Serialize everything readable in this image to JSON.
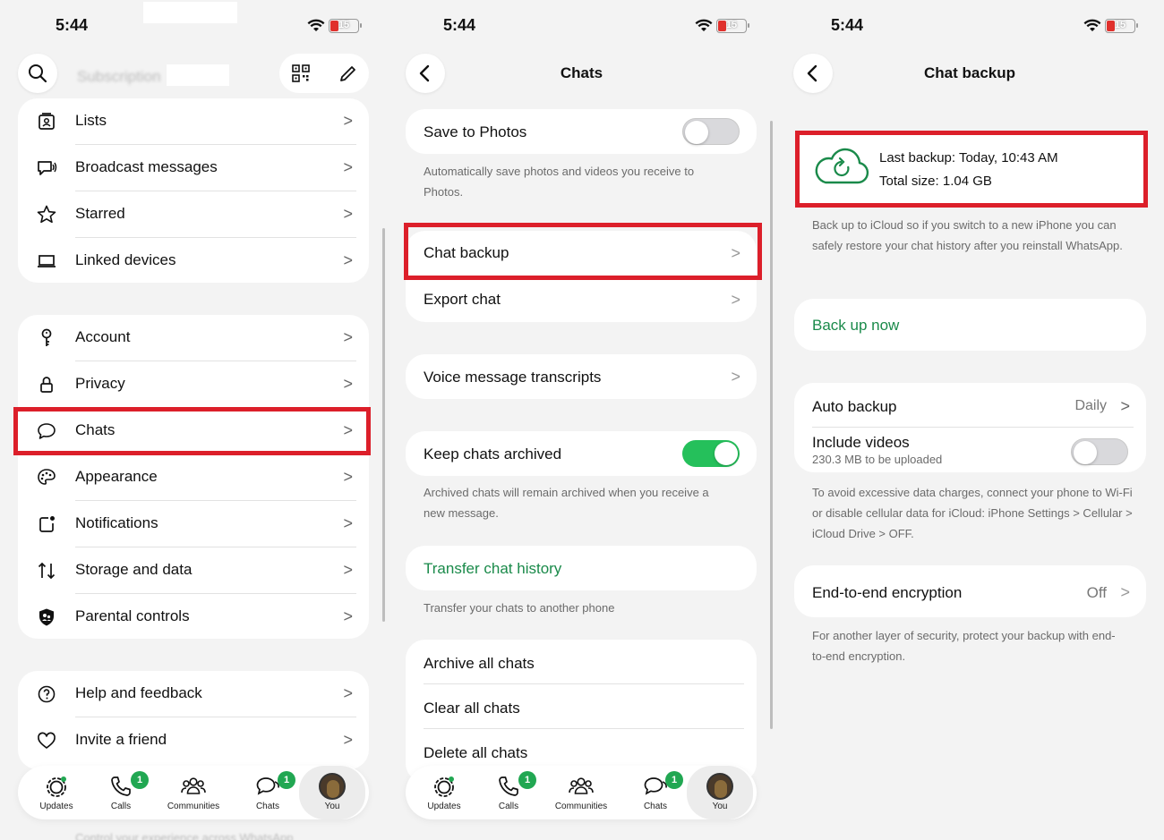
{
  "status": {
    "time": "5:44",
    "battery": "15"
  },
  "panel1": {
    "search_placeholder": "Subscription",
    "group1": [
      {
        "label": "Lists",
        "icon": "lists-icon"
      },
      {
        "label": "Broadcast messages",
        "icon": "broadcast-icon"
      },
      {
        "label": "Starred",
        "icon": "star-icon"
      },
      {
        "label": "Linked devices",
        "icon": "laptop-icon"
      }
    ],
    "group2": [
      {
        "label": "Account",
        "icon": "key-icon"
      },
      {
        "label": "Privacy",
        "icon": "lock-icon"
      },
      {
        "label": "Chats",
        "icon": "chat-bubble-icon"
      },
      {
        "label": "Appearance",
        "icon": "palette-icon"
      },
      {
        "label": "Notifications",
        "icon": "notification-icon"
      },
      {
        "label": "Storage and data",
        "icon": "storage-arrows-icon"
      },
      {
        "label": "Parental controls",
        "icon": "parental-shield-icon"
      }
    ],
    "group3": [
      {
        "label": "Help and feedback",
        "icon": "help-icon"
      },
      {
        "label": "Invite a friend",
        "icon": "heart-icon"
      }
    ],
    "footer_text": "Control your experience across WhatsApp"
  },
  "panel2": {
    "title": "Chats",
    "save_to_photos": "Save to Photos",
    "save_hint": "Automatically save photos and videos you receive to Photos.",
    "chat_backup": "Chat backup",
    "export_chat": "Export chat",
    "voice_transcripts": "Voice message transcripts",
    "keep_archived": "Keep chats archived",
    "archived_hint": "Archived chats will remain archived when you receive a new message.",
    "transfer_history": "Transfer chat history",
    "transfer_hint": "Transfer your chats to another phone",
    "archive_all": "Archive all chats",
    "clear_all": "Clear all chats",
    "delete_all": "Delete all chats"
  },
  "panel3": {
    "title": "Chat backup",
    "last_backup": "Last backup: Today, 10:43 AM",
    "total_size": "Total size: 1.04 GB",
    "backup_hint": "Back up to iCloud so if you switch to a new iPhone you can safely restore your chat history after you reinstall WhatsApp.",
    "back_up_now": "Back up now",
    "auto_backup": "Auto backup",
    "auto_backup_value": "Daily",
    "include_videos": "Include videos",
    "include_videos_sub": "230.3 MB to be uploaded",
    "data_hint": "To avoid excessive data charges, connect your phone to Wi-Fi or disable cellular data for iCloud: iPhone Settings > Cellular > iCloud Drive > OFF.",
    "e2e": "End-to-end encryption",
    "e2e_value": "Off",
    "e2e_hint": "For another layer of security, protect your backup with end-to-end encryption."
  },
  "tabbar": {
    "updates": "Updates",
    "calls": "Calls",
    "calls_badge": "1",
    "communities": "Communities",
    "chats": "Chats",
    "chats_badge": "1",
    "you": "You"
  },
  "colors": {
    "accent_green": "#1a8a4a",
    "danger_red": "#d0273f",
    "highlight": "#dc1f2a",
    "toggle_on": "#25c05b"
  }
}
